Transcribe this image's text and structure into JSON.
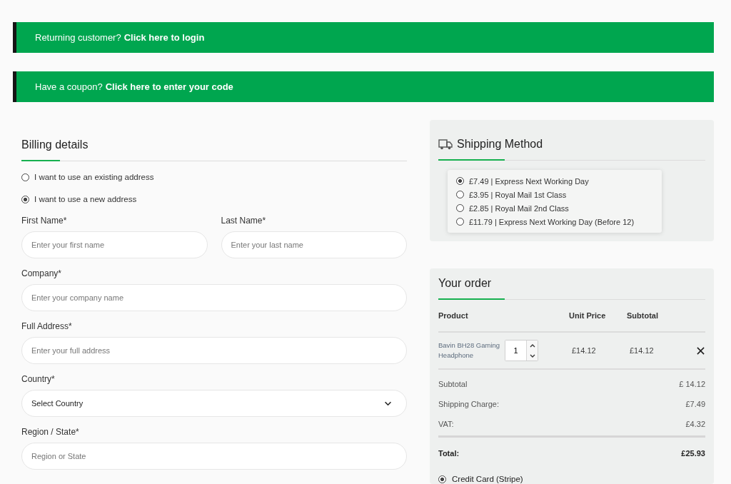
{
  "notices": [
    {
      "text": "Returning customer?",
      "link": "Click here to login"
    },
    {
      "text": "Have a coupon?",
      "link": "Click here to enter your code"
    }
  ],
  "billing": {
    "title": "Billing details",
    "address_options": [
      {
        "label": "I want to use an existing address",
        "selected": false
      },
      {
        "label": "I want to use a new address",
        "selected": true
      }
    ],
    "field_rows": [
      [
        {
          "kind": "input",
          "label": "First Name*",
          "placeholder": "Enter your first name"
        },
        {
          "kind": "input",
          "label": "Last Name*",
          "placeholder": "Enter your last name"
        }
      ],
      [
        {
          "kind": "input",
          "label": "Company*",
          "placeholder": "Enter your company name"
        }
      ],
      [
        {
          "kind": "input",
          "label": "Full Address*",
          "placeholder": "Enter your full address"
        }
      ],
      [
        {
          "kind": "select",
          "label": "Country*",
          "value": "Select Country"
        }
      ],
      [
        {
          "kind": "input",
          "label": "Region / State*",
          "placeholder": "Region or State"
        }
      ]
    ]
  },
  "shipping": {
    "title": "Shipping Method",
    "options": [
      {
        "label": "£7.49 | Express Next Working Day",
        "selected": true
      },
      {
        "label": "£3.95 | Royal Mail 1st Class",
        "selected": false
      },
      {
        "label": "£2.85 | Royal Mail 2nd Class",
        "selected": false
      },
      {
        "label": "£11.79 | Express Next Working Day (Before 12)",
        "selected": false
      }
    ]
  },
  "order": {
    "title": "Your order",
    "columns": [
      "Product",
      "Unit Price",
      "Subtotal"
    ],
    "items": [
      {
        "product": "Bavin BH28 Gaming Headphone",
        "quantity": "1",
        "unit_price": "£14.12",
        "subtotal": "£14.12"
      }
    ],
    "summary": [
      {
        "label": "Subtotal",
        "value": "£ 14.12"
      },
      {
        "label": "Shipping Charge:",
        "value": "£7.49"
      },
      {
        "label": "VAT:",
        "value": "£4.32"
      }
    ],
    "total": {
      "label": "Total:",
      "value": "£25.93"
    },
    "payment_methods": [
      {
        "label": "Credit Card (Stripe)",
        "selected": true
      }
    ]
  }
}
